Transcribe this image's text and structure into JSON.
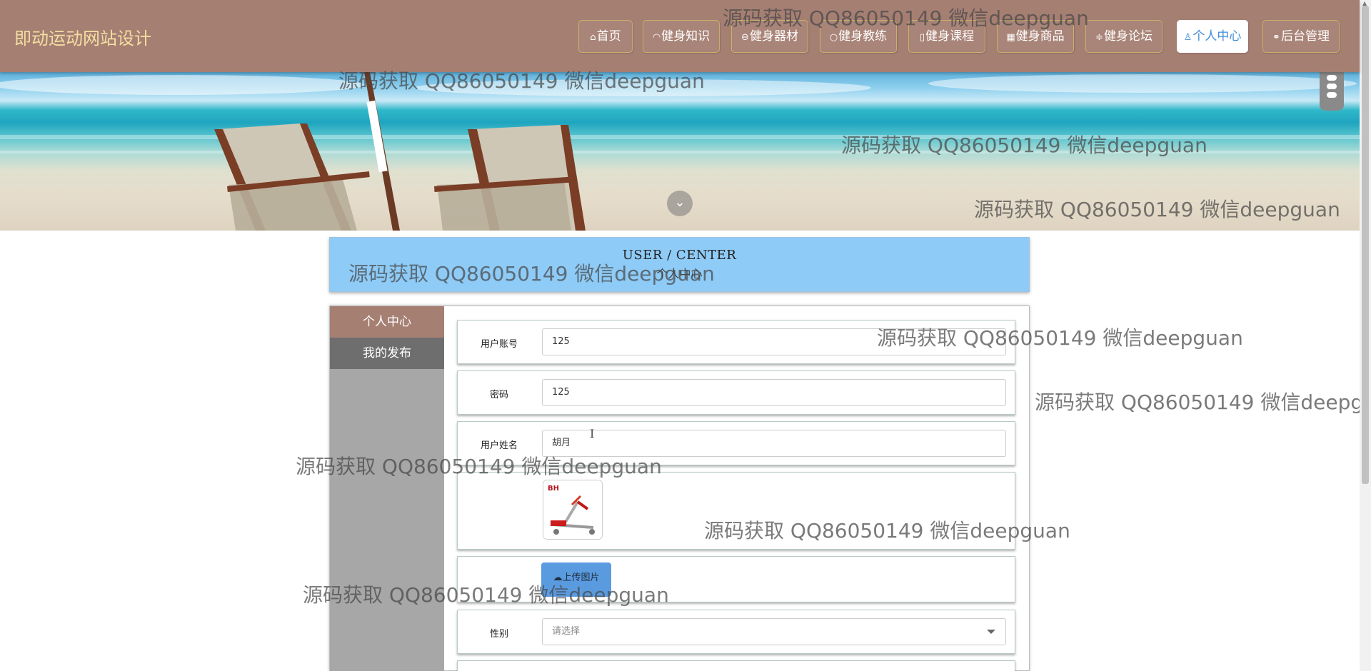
{
  "brand": "即动运动网站设计",
  "nav": [
    {
      "label": "首页",
      "icon": "home-icon",
      "glyph": "⌂",
      "active": false
    },
    {
      "label": "健身知识",
      "icon": "dashboard-icon",
      "glyph": "◠",
      "active": false
    },
    {
      "label": "健身器材",
      "icon": "gauge-icon",
      "glyph": "⊖",
      "active": false
    },
    {
      "label": "健身教练",
      "icon": "circle-icon",
      "glyph": "○",
      "active": false
    },
    {
      "label": "健身课程",
      "icon": "document-icon",
      "glyph": "▯",
      "active": false
    },
    {
      "label": "健身商品",
      "icon": "grid-icon",
      "glyph": "▦",
      "active": false
    },
    {
      "label": "健身论坛",
      "icon": "filter-icon",
      "glyph": "≑",
      "active": false
    },
    {
      "label": "个人中心",
      "icon": "user-icon",
      "glyph": "♙",
      "active": true
    },
    {
      "label": "后台管理",
      "icon": "link-icon",
      "glyph": "⚭",
      "active": false
    }
  ],
  "title": {
    "en": "USER / CENTER",
    "cn": "个人中心"
  },
  "sidebar": [
    {
      "label": "个人中心",
      "active": true
    },
    {
      "label": "我的发布",
      "active": false
    }
  ],
  "form": {
    "account": {
      "label": "用户账号",
      "value": "125"
    },
    "password": {
      "label": "密码",
      "value": "125"
    },
    "name": {
      "label": "用户姓名",
      "value": "胡月"
    },
    "upload_label": "上传图片",
    "gender": {
      "label": "性别",
      "placeholder": "请选择"
    }
  },
  "watermark": "源码获取 QQ86050149 微信deepguan",
  "colors": {
    "nav_bg": "#a67f73",
    "brand": "#f3dfa2",
    "title_bg": "#8ecbf7",
    "upload_btn": "#5a9be0"
  }
}
